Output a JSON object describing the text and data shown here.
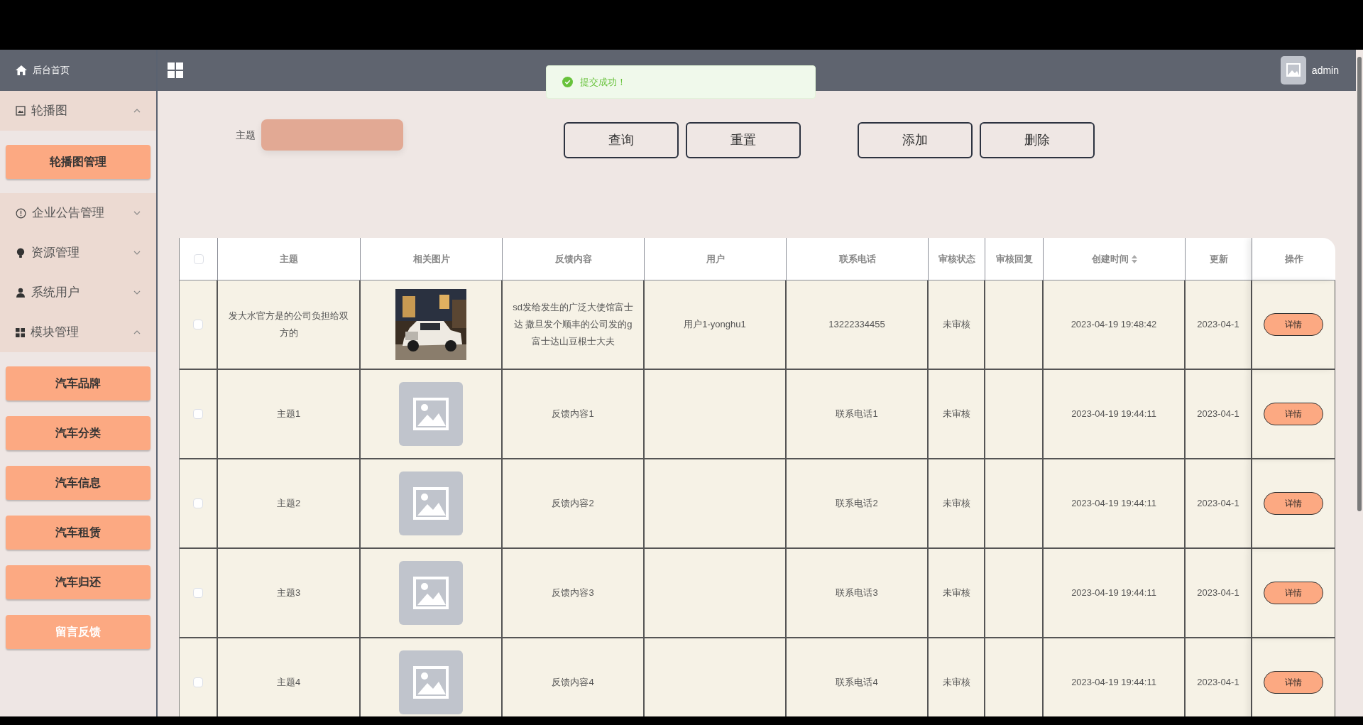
{
  "header": {
    "home": "后台首页",
    "user": "admin"
  },
  "toast": {
    "message": "提交成功！"
  },
  "sidebar": {
    "groups": [
      {
        "label": "轮播图",
        "expanded": true,
        "children": [
          {
            "label": "轮播图管理",
            "selected": false
          }
        ]
      },
      {
        "label": "企业公告管理",
        "expanded": false
      },
      {
        "label": "资源管理",
        "expanded": false
      },
      {
        "label": "系统用户",
        "expanded": false
      },
      {
        "label": "模块管理",
        "expanded": true,
        "children": [
          {
            "label": "汽车品牌",
            "selected": false
          },
          {
            "label": "汽车分类",
            "selected": false
          },
          {
            "label": "汽车信息",
            "selected": false
          },
          {
            "label": "汽车租赁",
            "selected": false
          },
          {
            "label": "汽车归还",
            "selected": false
          },
          {
            "label": "留言反馈",
            "selected": true
          }
        ]
      }
    ]
  },
  "search": {
    "label": "主题"
  },
  "buttons": [
    "查询",
    "重置",
    "添加",
    "删除"
  ],
  "table": {
    "header_checked": false,
    "columns": [
      {
        "label": "主题",
        "sortable": false
      },
      {
        "label": "相关图片",
        "sortable": false
      },
      {
        "label": "反馈内容",
        "sortable": false
      },
      {
        "label": "用户",
        "sortable": false
      },
      {
        "label": "联系电话",
        "sortable": false
      },
      {
        "label": "审核状态",
        "sortable": false
      },
      {
        "label": "审核回复",
        "sortable": false
      },
      {
        "label": "创建时间",
        "sortable": true
      },
      {
        "label": "更新",
        "sortable": false
      },
      {
        "label": "操作",
        "sortable": false
      }
    ],
    "rows": [
      {
        "checked": false,
        "subject": "发大水官方是的公司负担给双方的",
        "content": "sd发给发生的广泛大使馆富士达 撒旦发个顺丰的公司发的g富士达山豆根士大夫",
        "user": "用户1-yonghu1",
        "phone": "13222334455",
        "status": "未审核",
        "created": "2023-04-19 19:48:42",
        "updated": "2023-04-1",
        "action": "详情"
      },
      {
        "checked": false,
        "subject": "主题1",
        "kind": "placeholder",
        "content": "反馈内容1",
        "phone": "联系电话1",
        "status": "未审核",
        "created": "2023-04-19 19:44:11",
        "updated": "2023-04-1",
        "action": "详情"
      },
      {
        "checked": false,
        "subject": "主题2",
        "kind": "placeholder",
        "content": "反馈内容2",
        "phone": "联系电话2",
        "status": "未审核",
        "created": "2023-04-19 19:44:11",
        "updated": "2023-04-1",
        "action": "详情"
      },
      {
        "checked": false,
        "subject": "主题3",
        "kind": "placeholder",
        "content": "反馈内容3",
        "phone": "联系电话3",
        "status": "未审核",
        "created": "2023-04-19 19:44:11",
        "updated": "2023-04-1",
        "action": "详情"
      },
      {
        "checked": false,
        "subject": "主题4",
        "kind": "placeholder",
        "content": "反馈内容4",
        "phone": "联系电话4",
        "status": "未审核",
        "created": "2023-04-19 19:44:11",
        "updated": "2023-04-1",
        "action": "详情"
      }
    ]
  }
}
